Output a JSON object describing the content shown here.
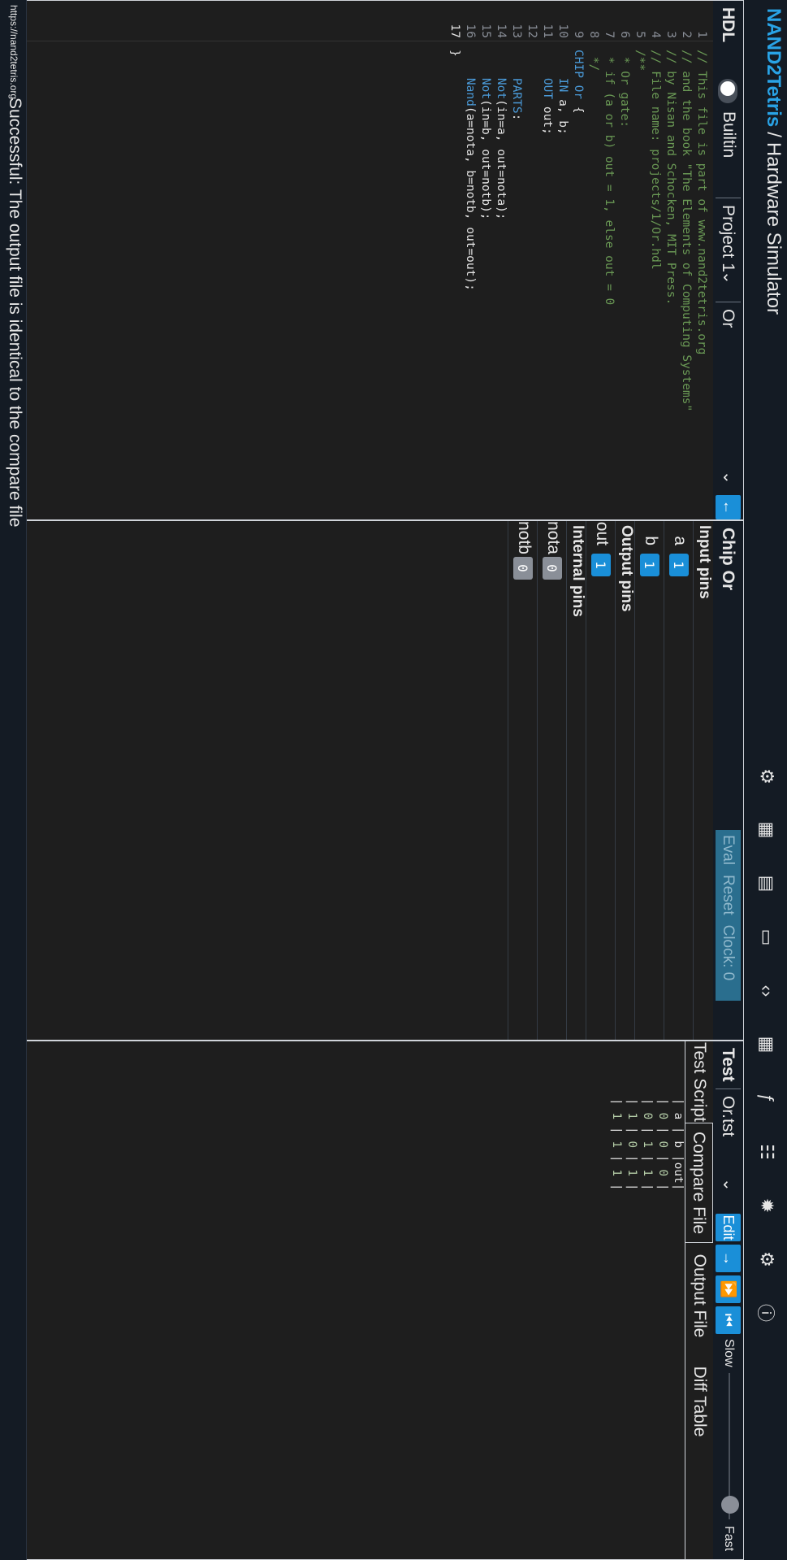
{
  "header": {
    "brand": "NAND2Tetris",
    "separator": "/",
    "title": "Hardware Simulator",
    "icons": [
      "chip-icon",
      "memory-icon",
      "ram-icon",
      "screen-icon",
      "code-icon",
      "grid-icon",
      "function-icon",
      "book-icon",
      "bug-icon",
      "settings-icon",
      "info-icon"
    ]
  },
  "hdl": {
    "title": "HDL",
    "toggle_label": "Builtin",
    "project_label": "Project 1",
    "chip_label": "Or",
    "lines": [
      {
        "n": "1",
        "t": "// This file is part of www.nand2tetris.org"
      },
      {
        "n": "2",
        "t": "// and the book \"The Elements of Computing Systems\""
      },
      {
        "n": "3",
        "t": "// by Nisan and Schocken, MIT Press."
      },
      {
        "n": "4",
        "t": "// File name: projects/1/Or.hdl"
      },
      {
        "n": "5",
        "t": "/**"
      },
      {
        "n": "6",
        "t": " * Or gate:"
      },
      {
        "n": "7",
        "t": " * if (a or b) out = 1, else out = 0"
      },
      {
        "n": "8",
        "t": " */"
      },
      {
        "n": "9",
        "t": "CHIP Or {"
      },
      {
        "n": "10",
        "t": "    IN a, b;"
      },
      {
        "n": "11",
        "t": "    OUT out;"
      },
      {
        "n": "12",
        "t": ""
      },
      {
        "n": "13",
        "t": "    PARTS:"
      },
      {
        "n": "14",
        "t": "    Not(in=a, out=nota);"
      },
      {
        "n": "15",
        "t": "    Not(in=b, out=notb);"
      },
      {
        "n": "16",
        "t": "    Nand(a=nota, b=notb, out=out);"
      },
      {
        "n": "17",
        "t": "}"
      }
    ]
  },
  "chip": {
    "title": "Chip Or",
    "eval_label": "Eval",
    "reset_label": "Reset",
    "clock_label": "Clock: 0",
    "input_title": "Input pins",
    "output_title": "Output pins",
    "internal_title": "Internal pins",
    "inputs": [
      {
        "name": "a",
        "value": "1"
      },
      {
        "name": "b",
        "value": "1"
      }
    ],
    "outputs": [
      {
        "name": "out",
        "value": "1"
      }
    ],
    "internals": [
      {
        "name": "nota",
        "value": "0"
      },
      {
        "name": "notb",
        "value": "0"
      }
    ]
  },
  "test": {
    "title": "Test",
    "file_label": "Or.tst",
    "edit_label": "Edit",
    "slow_label": "Slow",
    "fast_label": "Fast",
    "speed_level": 0.9,
    "tabs": [
      "Test Script",
      "Compare File",
      "Output File",
      "Diff Table"
    ],
    "active_tab": 1,
    "compare_lines": [
      "| a | b |out|",
      "| 0 | 0 | 0 |",
      "| 0 | 1 | 1 |",
      "| 1 | 0 | 1 |",
      "| 1 | 1 | 1 |"
    ]
  },
  "footer": {
    "link": "https://nand2tetris.org",
    "message": "Successful: The output file is identical to the compare file"
  },
  "colors": {
    "accent": "#1a8fd8",
    "brand": "#29a3e6",
    "comment": "#6a9955",
    "keyword": "#4a9ad8"
  }
}
